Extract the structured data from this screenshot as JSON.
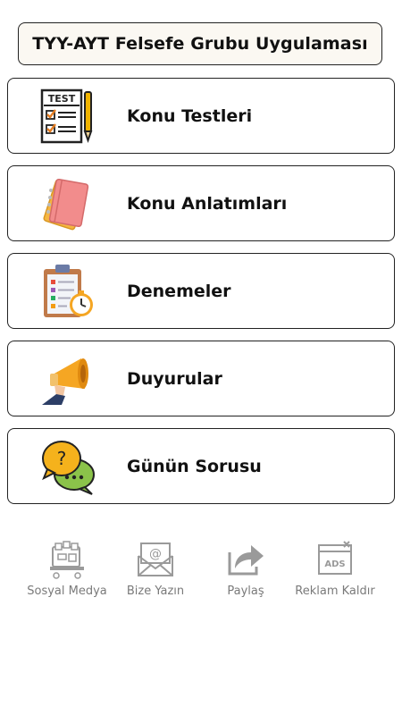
{
  "header": {
    "title": "TYY-AYT Felsefe Grubu Uygulaması"
  },
  "menu": [
    {
      "label": "Konu Testleri",
      "icon": "test-checklist-icon"
    },
    {
      "label": "Konu Anlatımları",
      "icon": "notebooks-icon"
    },
    {
      "label": "Denemeler",
      "icon": "clipboard-clock-icon"
    },
    {
      "label": "Duyurular",
      "icon": "megaphone-icon"
    },
    {
      "label": "Günün Sorusu",
      "icon": "speech-question-icon"
    }
  ],
  "bottom": [
    {
      "label": "Sosyal Medya",
      "icon": "social-media-icon"
    },
    {
      "label": "Bize Yazın",
      "icon": "email-icon"
    },
    {
      "label": "Paylaş",
      "icon": "share-icon"
    },
    {
      "label": "Reklam Kaldır",
      "icon": "remove-ads-icon"
    }
  ],
  "icon_text": {
    "test": "TEST",
    "ads": "ADS",
    "question": "?"
  },
  "colors": {
    "title_bg": "#fbf8f2",
    "border": "#222222",
    "muted_label": "#7a7a7a",
    "icon_gray": "#9a9a9a"
  }
}
